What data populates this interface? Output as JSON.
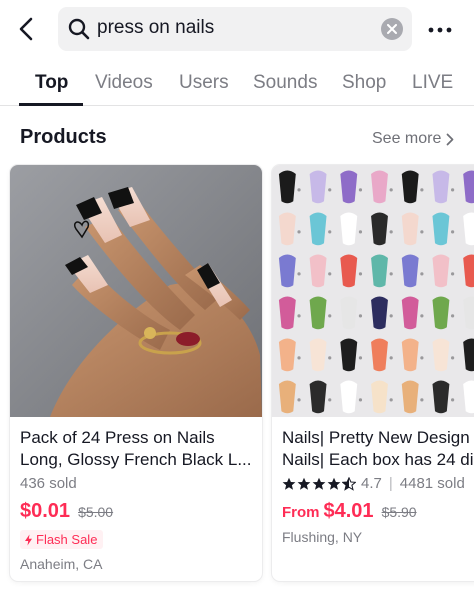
{
  "search": {
    "query": "press on nails"
  },
  "tabs": [
    {
      "label": "Top"
    },
    {
      "label": "Videos"
    },
    {
      "label": "Users"
    },
    {
      "label": "Sounds"
    },
    {
      "label": "Shop"
    },
    {
      "label": "LIVE"
    }
  ],
  "section": {
    "title": "Products",
    "see_more": "See more"
  },
  "products": [
    {
      "title_line1": "Pack of 24 Press on Nails",
      "title_line2": "Long, Glossy French Black L...",
      "sold": "436 sold",
      "price": "$0.01",
      "original_price": "$5.00",
      "badge": "Flash Sale",
      "location": "Anaheim, CA"
    },
    {
      "title_line1": "Nails| Pretty New Design",
      "title_line2": "Nails| Each box has 24 di",
      "rating": "4.7",
      "rating_value": 4.7,
      "sold": "4481 sold",
      "price_prefix": "From",
      "price": "$4.01",
      "original_price": "$5.90",
      "location": "Flushing, NY"
    }
  ],
  "colors": {
    "accent": "#fe2c55",
    "text": "#161823",
    "muted": "#7c7d84"
  }
}
